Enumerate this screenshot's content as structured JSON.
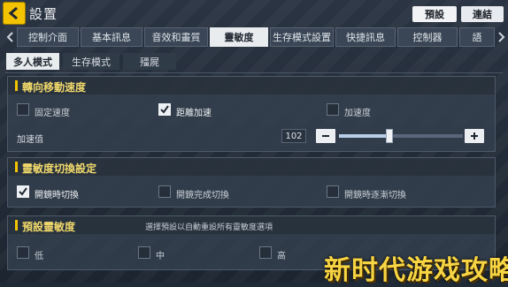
{
  "window": {
    "title": "設置"
  },
  "header": {
    "preset_label": "預設",
    "link_label": "連結"
  },
  "tabs": [
    {
      "label": "控制介面"
    },
    {
      "label": "基本訊息"
    },
    {
      "label": "音效和畫質"
    },
    {
      "label": "靈敏度",
      "active": true
    },
    {
      "label": "生存模式設置"
    },
    {
      "label": "快捷訊息"
    },
    {
      "label": "控制器"
    },
    {
      "label": "語"
    }
  ],
  "subtabs": [
    {
      "label": "多人模式",
      "active": true
    },
    {
      "label": "生存模式"
    },
    {
      "label": "殭屍"
    }
  ],
  "turn_section": {
    "title": "轉向移動速度",
    "options": [
      {
        "label": "固定速度",
        "checked": false
      },
      {
        "label": "距離加速",
        "checked": true
      },
      {
        "label": "加速度",
        "checked": false
      }
    ],
    "accel_label": "加速值",
    "accel_value": "102",
    "slider_fraction": 0.41
  },
  "sens_switch": {
    "title": "靈敏度切換設定",
    "options": [
      {
        "label": "開鏡時切換",
        "checked": true
      },
      {
        "label": "開鏡完成切換",
        "checked": false
      },
      {
        "label": "開鏡時逐漸切換",
        "checked": false
      }
    ]
  },
  "preset_sens": {
    "title": "預設靈敏度",
    "hint": "選擇預設以自動重設所有靈敏度選項",
    "options": [
      {
        "label": "低",
        "checked": false
      },
      {
        "label": "中",
        "checked": false
      },
      {
        "label": "高",
        "checked": false
      }
    ]
  },
  "watermark": "新时代游戏攻略",
  "colors": {
    "accent": "#f3c300",
    "panel": "#343f4d",
    "active_tab": "#e9ecef"
  }
}
